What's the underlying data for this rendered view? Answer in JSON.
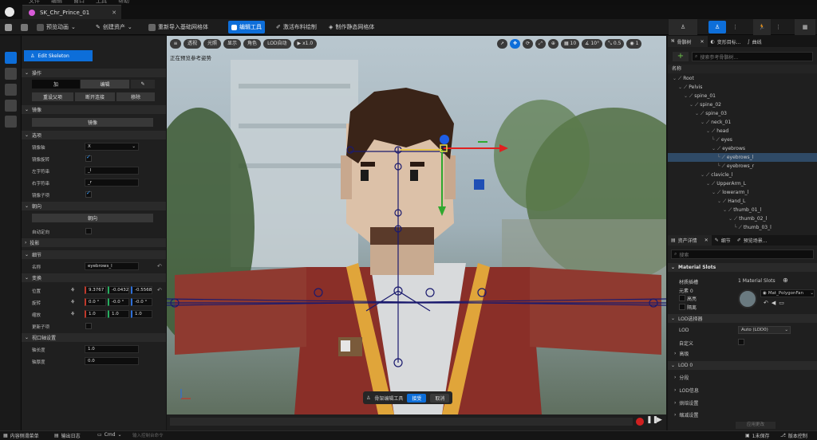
{
  "menubar": {
    "items": [
      "文件",
      "编辑",
      "窗口",
      "工具",
      "帮助"
    ]
  },
  "document_tab": {
    "label": "SK_Chr_Prince_01"
  },
  "toolbar": {
    "preview_anim": "预览动画",
    "create_asset": "创建资产",
    "reimport": "重新导入基础网格体",
    "edit_tools": "编辑工具",
    "cloth_paint": "激活布料绘制",
    "make_static": "制作静态网格体"
  },
  "left_panel": {
    "edit_skeleton_button": "Edit Skeleton",
    "ops_section": "操作",
    "add_button": "加",
    "edit_button": "编辑",
    "set_parent": "重设父项",
    "unparent": "断开连接",
    "remove": "移除",
    "mirror_section": "镜像",
    "mirror_button": "镜像",
    "options_section": "选项",
    "mirror_axis_label": "镜像轴",
    "mirror_axis_value": "X",
    "mirror_rot_label": "镜像旋转",
    "left_suffix_label": "左字符串",
    "left_suffix_value": "_l",
    "right_suffix_label": "右字符串",
    "right_suffix_value": "_r",
    "mirror_children_label": "镜像子项",
    "orient_section": "朝向",
    "orient_button": "朝向",
    "auto_orient_label": "自动定向",
    "project_section": "投影",
    "detail_section": "细节",
    "name_label": "名称",
    "name_value": "eyebrows_l",
    "transform_section": "变换",
    "location_label": "位置",
    "location_values": [
      "9.3767",
      "-0.0432",
      "-0.5568"
    ],
    "rotation_label": "旋转",
    "rotation_values": [
      "0.0 °",
      "-0.0 °",
      "-0.0 °"
    ],
    "scale_label": "缩放",
    "scale_values": [
      "1.0",
      "1.0",
      "1.0"
    ],
    "update_children_label": "更新子项",
    "viewport_section": "视口轴设置",
    "axis_length_label": "轴长度",
    "axis_length_value": "1.0",
    "axis_thickness_label": "轴厚度",
    "axis_thickness_value": "0.0"
  },
  "viewport": {
    "toolbar": {
      "perspective": "透视",
      "lit": "光照",
      "show": "显示",
      "character": "角色",
      "lod": "LOD自动",
      "play": "x1.0",
      "grid_snap": "10",
      "angle_snap": "10°",
      "scale_snap": "0.5",
      "camera_speed": "1"
    },
    "preview_note": "正在预览参考姿势",
    "edit_mode_bar": {
      "label": "骨架编辑工具",
      "accept": "接受",
      "cancel": "取消"
    }
  },
  "right_panel": {
    "tabs": [
      "骨骼树",
      "变形目标...",
      "曲线"
    ],
    "search_placeholder": "搜索参考骨骼树...",
    "name_header": "名称",
    "bones": [
      {
        "name": "Root",
        "depth": 0
      },
      {
        "name": "Pelvis",
        "depth": 1
      },
      {
        "name": "spine_01",
        "depth": 2
      },
      {
        "name": "spine_02",
        "depth": 3
      },
      {
        "name": "spine_03",
        "depth": 4
      },
      {
        "name": "neck_01",
        "depth": 5
      },
      {
        "name": "head",
        "depth": 6
      },
      {
        "name": "eyes",
        "depth": 7
      },
      {
        "name": "eyebrows",
        "depth": 7
      },
      {
        "name": "eyebrows_l",
        "depth": 8
      },
      {
        "name": "eyebrows_r",
        "depth": 8
      },
      {
        "name": "clavicle_l",
        "depth": 5
      },
      {
        "name": "UpperArm_L",
        "depth": 6
      },
      {
        "name": "lowerarm_l",
        "depth": 7
      },
      {
        "name": "Hand_L",
        "depth": 8
      },
      {
        "name": "thumb_01_l",
        "depth": 9
      },
      {
        "name": "thumb_02_l",
        "depth": 10
      },
      {
        "name": "thumb_03_l",
        "depth": 11
      }
    ],
    "selected_bone": "eyebrows_l",
    "lower_tabs": [
      "资产详情",
      "细节",
      "预览场景..."
    ],
    "details_search": "搜索",
    "material_slots_section": "Material Slots",
    "material_slots_label": "材质插槽",
    "material_slots_count": "1 Material Slots",
    "element0_label": "元素 0",
    "highlight_label": "高亮",
    "isolate_label": "隔离",
    "material_name": "Mat_PolygonFan",
    "lod_picker_section": "LOD选择器",
    "lod_label": "LOD",
    "lod_value": "Auto (LOD0)",
    "custom_label": "自定义",
    "advanced_label": "高级",
    "lod0_section": "LOD 0",
    "sub_sections": [
      "分段",
      "LOD信息",
      "烘焙设置",
      "缩减设置"
    ],
    "apply_changes": "应用更改"
  },
  "status": {
    "content_drawer": "内容侧滑菜单",
    "output_log": "输出日志",
    "cmd": "Cmd",
    "cmd_placeholder": "输入控制台命令",
    "unsaved": "1未保存",
    "source_control": "版本控制"
  },
  "colors": {
    "accent": "#0d6ed9",
    "selection": "#2f4a66",
    "panel": "#1f1f1f"
  }
}
